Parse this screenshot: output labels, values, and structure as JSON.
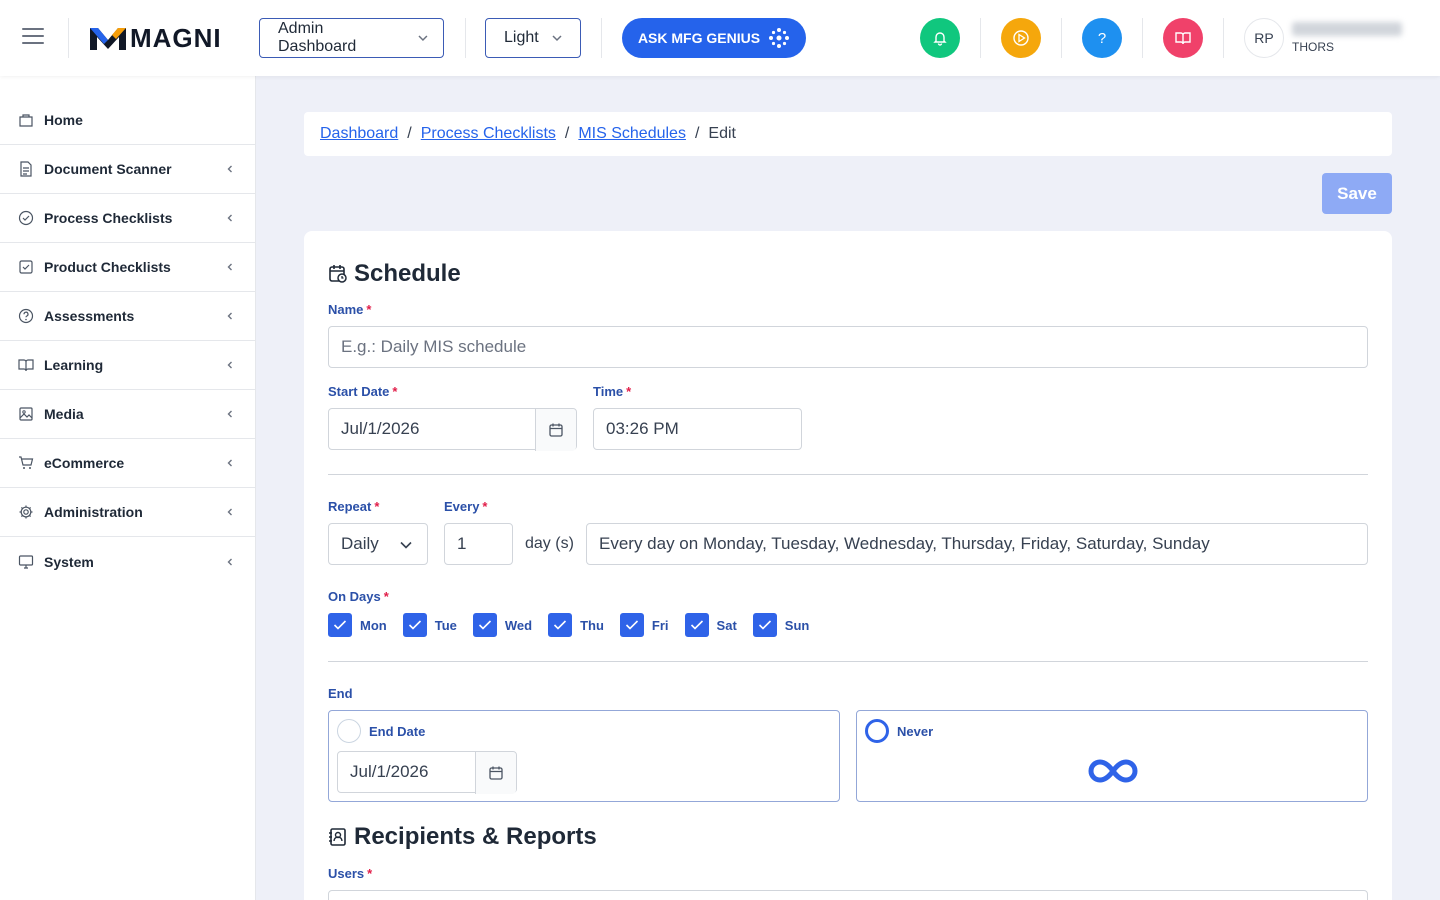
{
  "topbar": {
    "logo_text": "MAGNI",
    "dashboard_select": "Admin Dashboard",
    "theme_select": "Light",
    "genius_label": "ASK MFG GENIUS",
    "icons": [
      {
        "name": "bell-icon",
        "color": "#10c77e"
      },
      {
        "name": "play-icon",
        "color": "#f5a70c"
      },
      {
        "name": "help-icon",
        "color": "#1e90f0"
      },
      {
        "name": "book-icon",
        "color": "#f0416a"
      }
    ],
    "help_glyph": "?",
    "avatar_initials": "RP",
    "user_org": "THORS"
  },
  "sidebar": {
    "items": [
      {
        "label": "Home",
        "icon": "home-icon",
        "has_children": false
      },
      {
        "label": "Document Scanner",
        "icon": "document-icon",
        "has_children": true
      },
      {
        "label": "Process Checklists",
        "icon": "check-circle-icon",
        "has_children": true
      },
      {
        "label": "Product Checklists",
        "icon": "check-square-icon",
        "has_children": true
      },
      {
        "label": "Assessments",
        "icon": "question-circle-icon",
        "has_children": true
      },
      {
        "label": "Learning",
        "icon": "book-open-icon",
        "has_children": true
      },
      {
        "label": "Media",
        "icon": "image-icon",
        "has_children": true
      },
      {
        "label": "eCommerce",
        "icon": "cart-icon",
        "has_children": true
      },
      {
        "label": "Administration",
        "icon": "gear-icon",
        "has_children": true
      },
      {
        "label": "System",
        "icon": "monitor-icon",
        "has_children": true
      }
    ]
  },
  "breadcrumb": {
    "items": [
      "Dashboard",
      "Process Checklists",
      "MIS Schedules"
    ],
    "separator": "/",
    "current": "Edit"
  },
  "actions": {
    "save_label": "Save"
  },
  "schedule": {
    "title": "Schedule",
    "name_label": "Name",
    "name_placeholder": "E.g.: Daily MIS schedule",
    "start_date_label": "Start Date",
    "start_date_value": "Jul/1/2026",
    "time_label": "Time",
    "time_value": "03:26 PM",
    "repeat_label": "Repeat",
    "repeat_value": "Daily",
    "every_label": "Every",
    "every_value": "1",
    "every_unit": "day (s)",
    "summary": "Every day on Monday, Tuesday, Wednesday, Thursday, Friday, Saturday, Sunday",
    "on_days_label": "On Days",
    "days": [
      {
        "label": "Mon",
        "checked": true
      },
      {
        "label": "Tue",
        "checked": true
      },
      {
        "label": "Wed",
        "checked": true
      },
      {
        "label": "Thu",
        "checked": true
      },
      {
        "label": "Fri",
        "checked": true
      },
      {
        "label": "Sat",
        "checked": true
      },
      {
        "label": "Sun",
        "checked": true
      }
    ],
    "end_label": "End",
    "end_date_label": "End Date",
    "end_date_value": "Jul/1/2026",
    "never_label": "Never",
    "selected_end": "Never",
    "required_mark": "*"
  },
  "recipients": {
    "title": "Recipients & Reports",
    "users_label": "Users"
  },
  "colors": {
    "accent": "#2563eb",
    "label_blue": "#2b50a8",
    "required": "#e11d48",
    "save_disabled": "#8eaaf5"
  }
}
